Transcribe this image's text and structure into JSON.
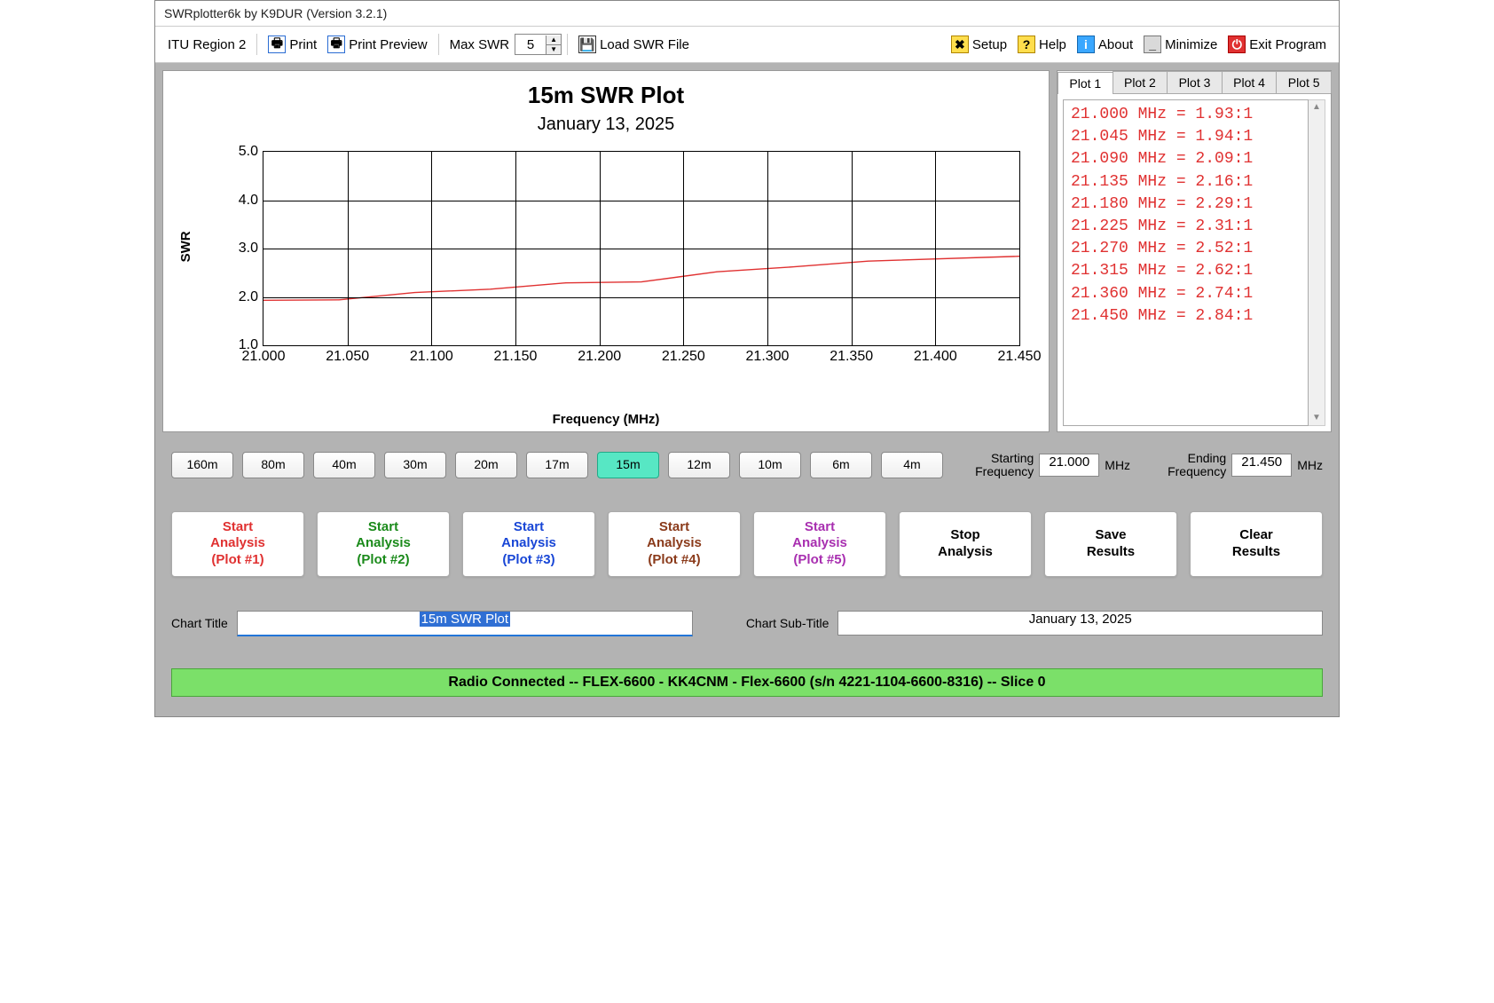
{
  "titlebar": "SWRplotter6k by K9DUR (Version 3.2.1)",
  "toolbar": {
    "region": "ITU Region 2",
    "print": "Print",
    "preview": "Print Preview",
    "maxswr_label": "Max SWR",
    "maxswr_value": "5",
    "load": "Load SWR File",
    "setup": "Setup",
    "help": "Help",
    "about": "About",
    "minimize": "Minimize",
    "exit": "Exit Program"
  },
  "chart_data": {
    "type": "line",
    "title": "15m SWR Plot",
    "subtitle": "January 13, 2025",
    "xlabel": "Frequency (MHz)",
    "ylabel": "SWR",
    "ylim": [
      1.0,
      5.0
    ],
    "xlim": [
      21.0,
      21.45
    ],
    "x_ticks": [
      "21.000",
      "21.050",
      "21.100",
      "21.150",
      "21.200",
      "21.250",
      "21.300",
      "21.350",
      "21.400",
      "21.450"
    ],
    "y_ticks": [
      "1.0",
      "2.0",
      "3.0",
      "4.0",
      "5.0"
    ],
    "x": [
      21.0,
      21.045,
      21.09,
      21.135,
      21.18,
      21.225,
      21.27,
      21.315,
      21.36,
      21.45
    ],
    "values": [
      1.93,
      1.94,
      2.09,
      2.16,
      2.29,
      2.31,
      2.52,
      2.62,
      2.74,
      2.84
    ],
    "series_color": "#e03131"
  },
  "data_tabs": [
    "Plot 1",
    "Plot 2",
    "Plot 3",
    "Plot 4",
    "Plot 5"
  ],
  "active_tab": 0,
  "data_list": [
    "21.000 MHz = 1.93:1",
    "21.045 MHz = 1.94:1",
    "21.090 MHz = 2.09:1",
    "21.135 MHz = 2.16:1",
    "21.180 MHz = 2.29:1",
    "21.225 MHz = 2.31:1",
    "21.270 MHz = 2.52:1",
    "21.315 MHz = 2.62:1",
    "21.360 MHz = 2.74:1",
    "21.450 MHz = 2.84:1"
  ],
  "bands": [
    "160m",
    "80m",
    "40m",
    "30m",
    "20m",
    "17m",
    "15m",
    "12m",
    "10m",
    "6m",
    "4m"
  ],
  "selected_band": "15m",
  "freq": {
    "start_label": "Starting\nFrequency",
    "start_value": "21.000",
    "end_label": "Ending\nFrequency",
    "end_value": "21.450",
    "unit": "MHz"
  },
  "analysis_buttons": [
    {
      "l1": "Start",
      "l2": "Analysis",
      "l3": "(Plot #1)",
      "color": "#e03131"
    },
    {
      "l1": "Start",
      "l2": "Analysis",
      "l3": "(Plot #2)",
      "color": "#1a8a1a"
    },
    {
      "l1": "Start",
      "l2": "Analysis",
      "l3": "(Plot #3)",
      "color": "#1846d6"
    },
    {
      "l1": "Start",
      "l2": "Analysis",
      "l3": "(Plot #4)",
      "color": "#8a3a1a"
    },
    {
      "l1": "Start",
      "l2": "Analysis",
      "l3": "(Plot #5)",
      "color": "#a82fb0"
    },
    {
      "l1": "Stop",
      "l2": "Analysis",
      "l3": "",
      "color": "#000"
    },
    {
      "l1": "Save",
      "l2": "Results",
      "l3": "",
      "color": "#000"
    },
    {
      "l1": "Clear",
      "l2": "Results",
      "l3": "",
      "color": "#000"
    }
  ],
  "titles": {
    "chart_title_label": "Chart Title",
    "chart_title_value": "15m SWR Plot",
    "sub_title_label": "Chart Sub-Title",
    "sub_title_value": "January 13, 2025"
  },
  "status": "Radio Connected -- FLEX-6600 - KK4CNM - Flex-6600  (s/n 4221-1104-6600-8316) -- Slice 0"
}
